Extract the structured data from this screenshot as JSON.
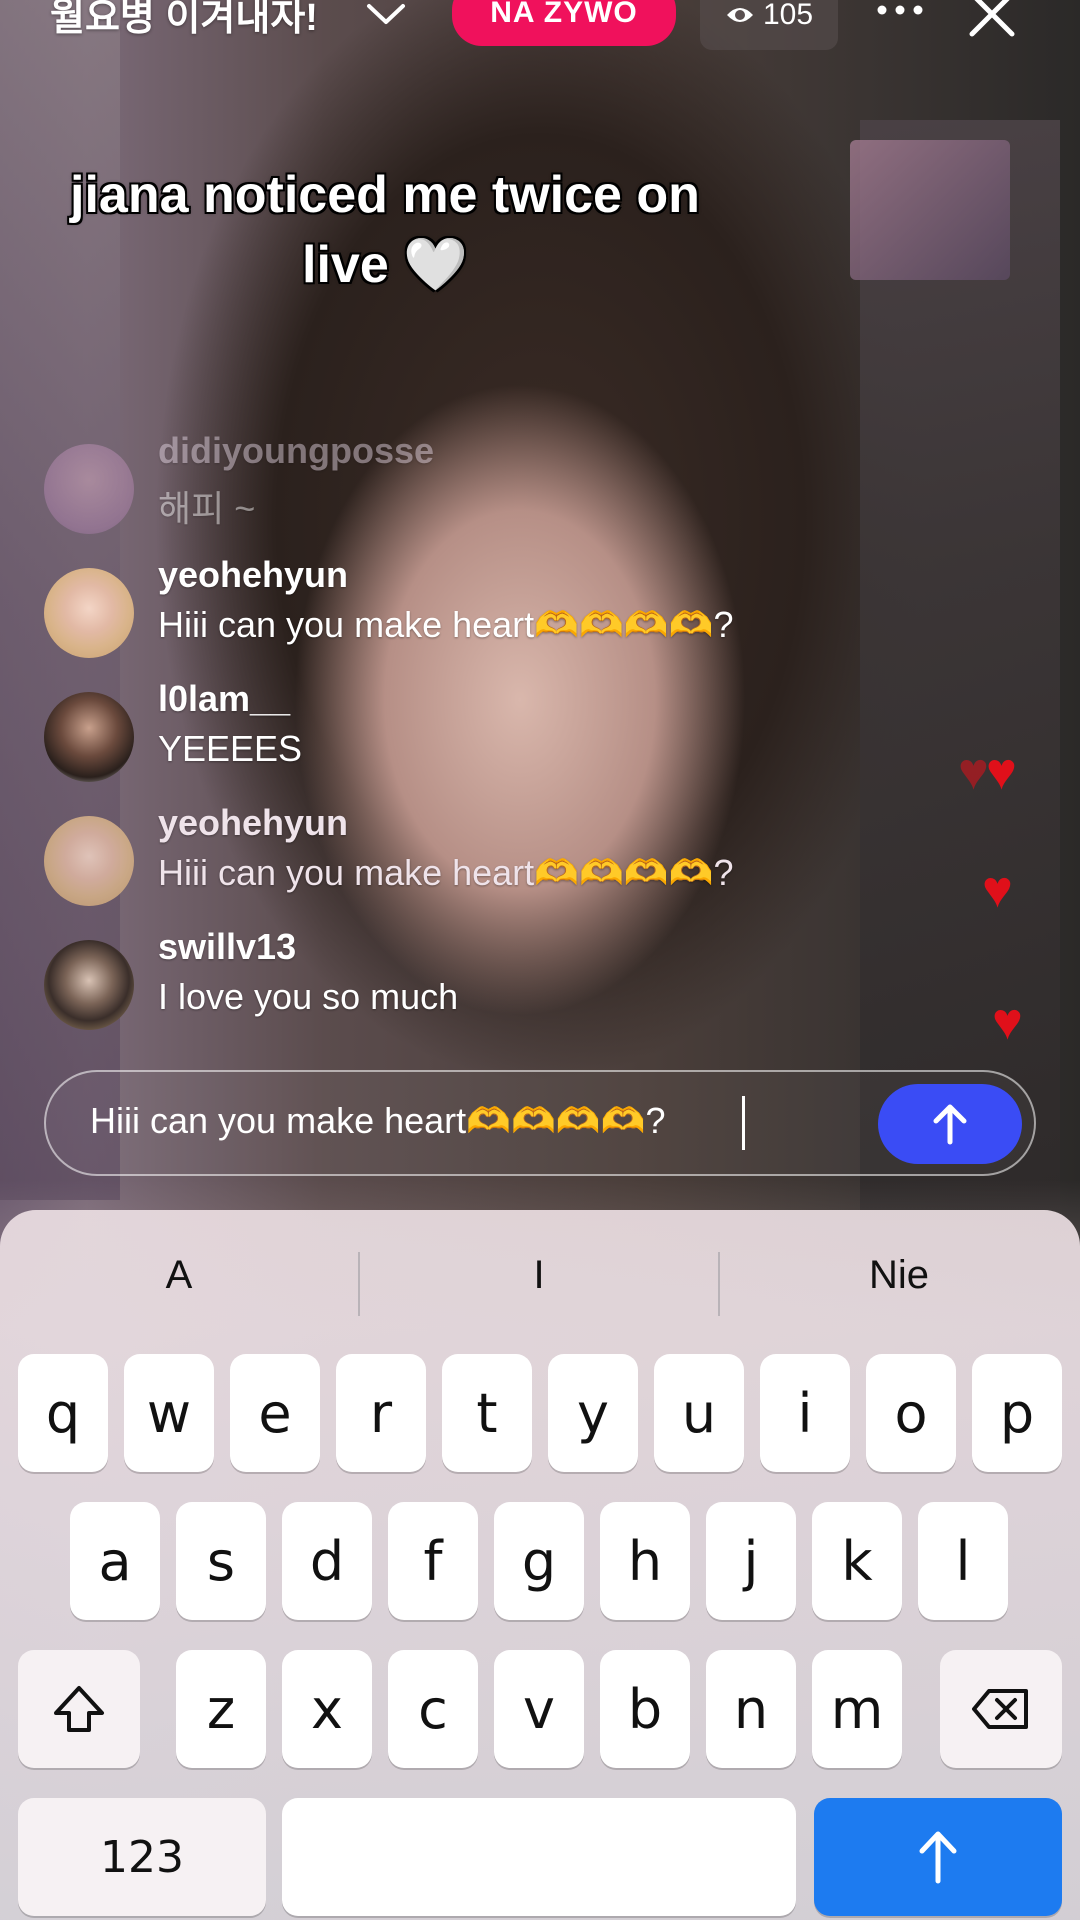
{
  "stream": {
    "title": "월요병 이겨내자!",
    "live_label": "NA ŻYWO",
    "viewer_count": "105"
  },
  "overlay": {
    "caption": "jiana noticed me twice on live 🤍"
  },
  "comments": [
    {
      "user": "didiyoungposse",
      "message": "해피 ~"
    },
    {
      "user": "yeohehyun",
      "message": "Hiii can you make heart🫶🫶🫶🫶?"
    },
    {
      "user": "l0lam__",
      "message": "YEEEES"
    },
    {
      "user": "yeohehyun",
      "message": "Hiii can you make heart🫶🫶🫶🫶?"
    },
    {
      "user": "swillv13",
      "message": "I love you so much"
    }
  ],
  "composer": {
    "value": "Hiii can you make heart🫶🫶🫶🫶?"
  },
  "keyboard": {
    "suggestions": [
      "A",
      "I",
      "Nie"
    ],
    "row1": [
      "q",
      "w",
      "e",
      "r",
      "t",
      "y",
      "u",
      "i",
      "o",
      "p"
    ],
    "row2": [
      "a",
      "s",
      "d",
      "f",
      "g",
      "h",
      "j",
      "k",
      "l"
    ],
    "row3": [
      "z",
      "x",
      "c",
      "v",
      "b",
      "n",
      "m"
    ],
    "numbers_label": "123"
  },
  "colors": {
    "live_badge": "#f0115c",
    "send_button": "#3a4cf5",
    "return_key": "#1d7bf0",
    "heart": "#e0101a"
  }
}
